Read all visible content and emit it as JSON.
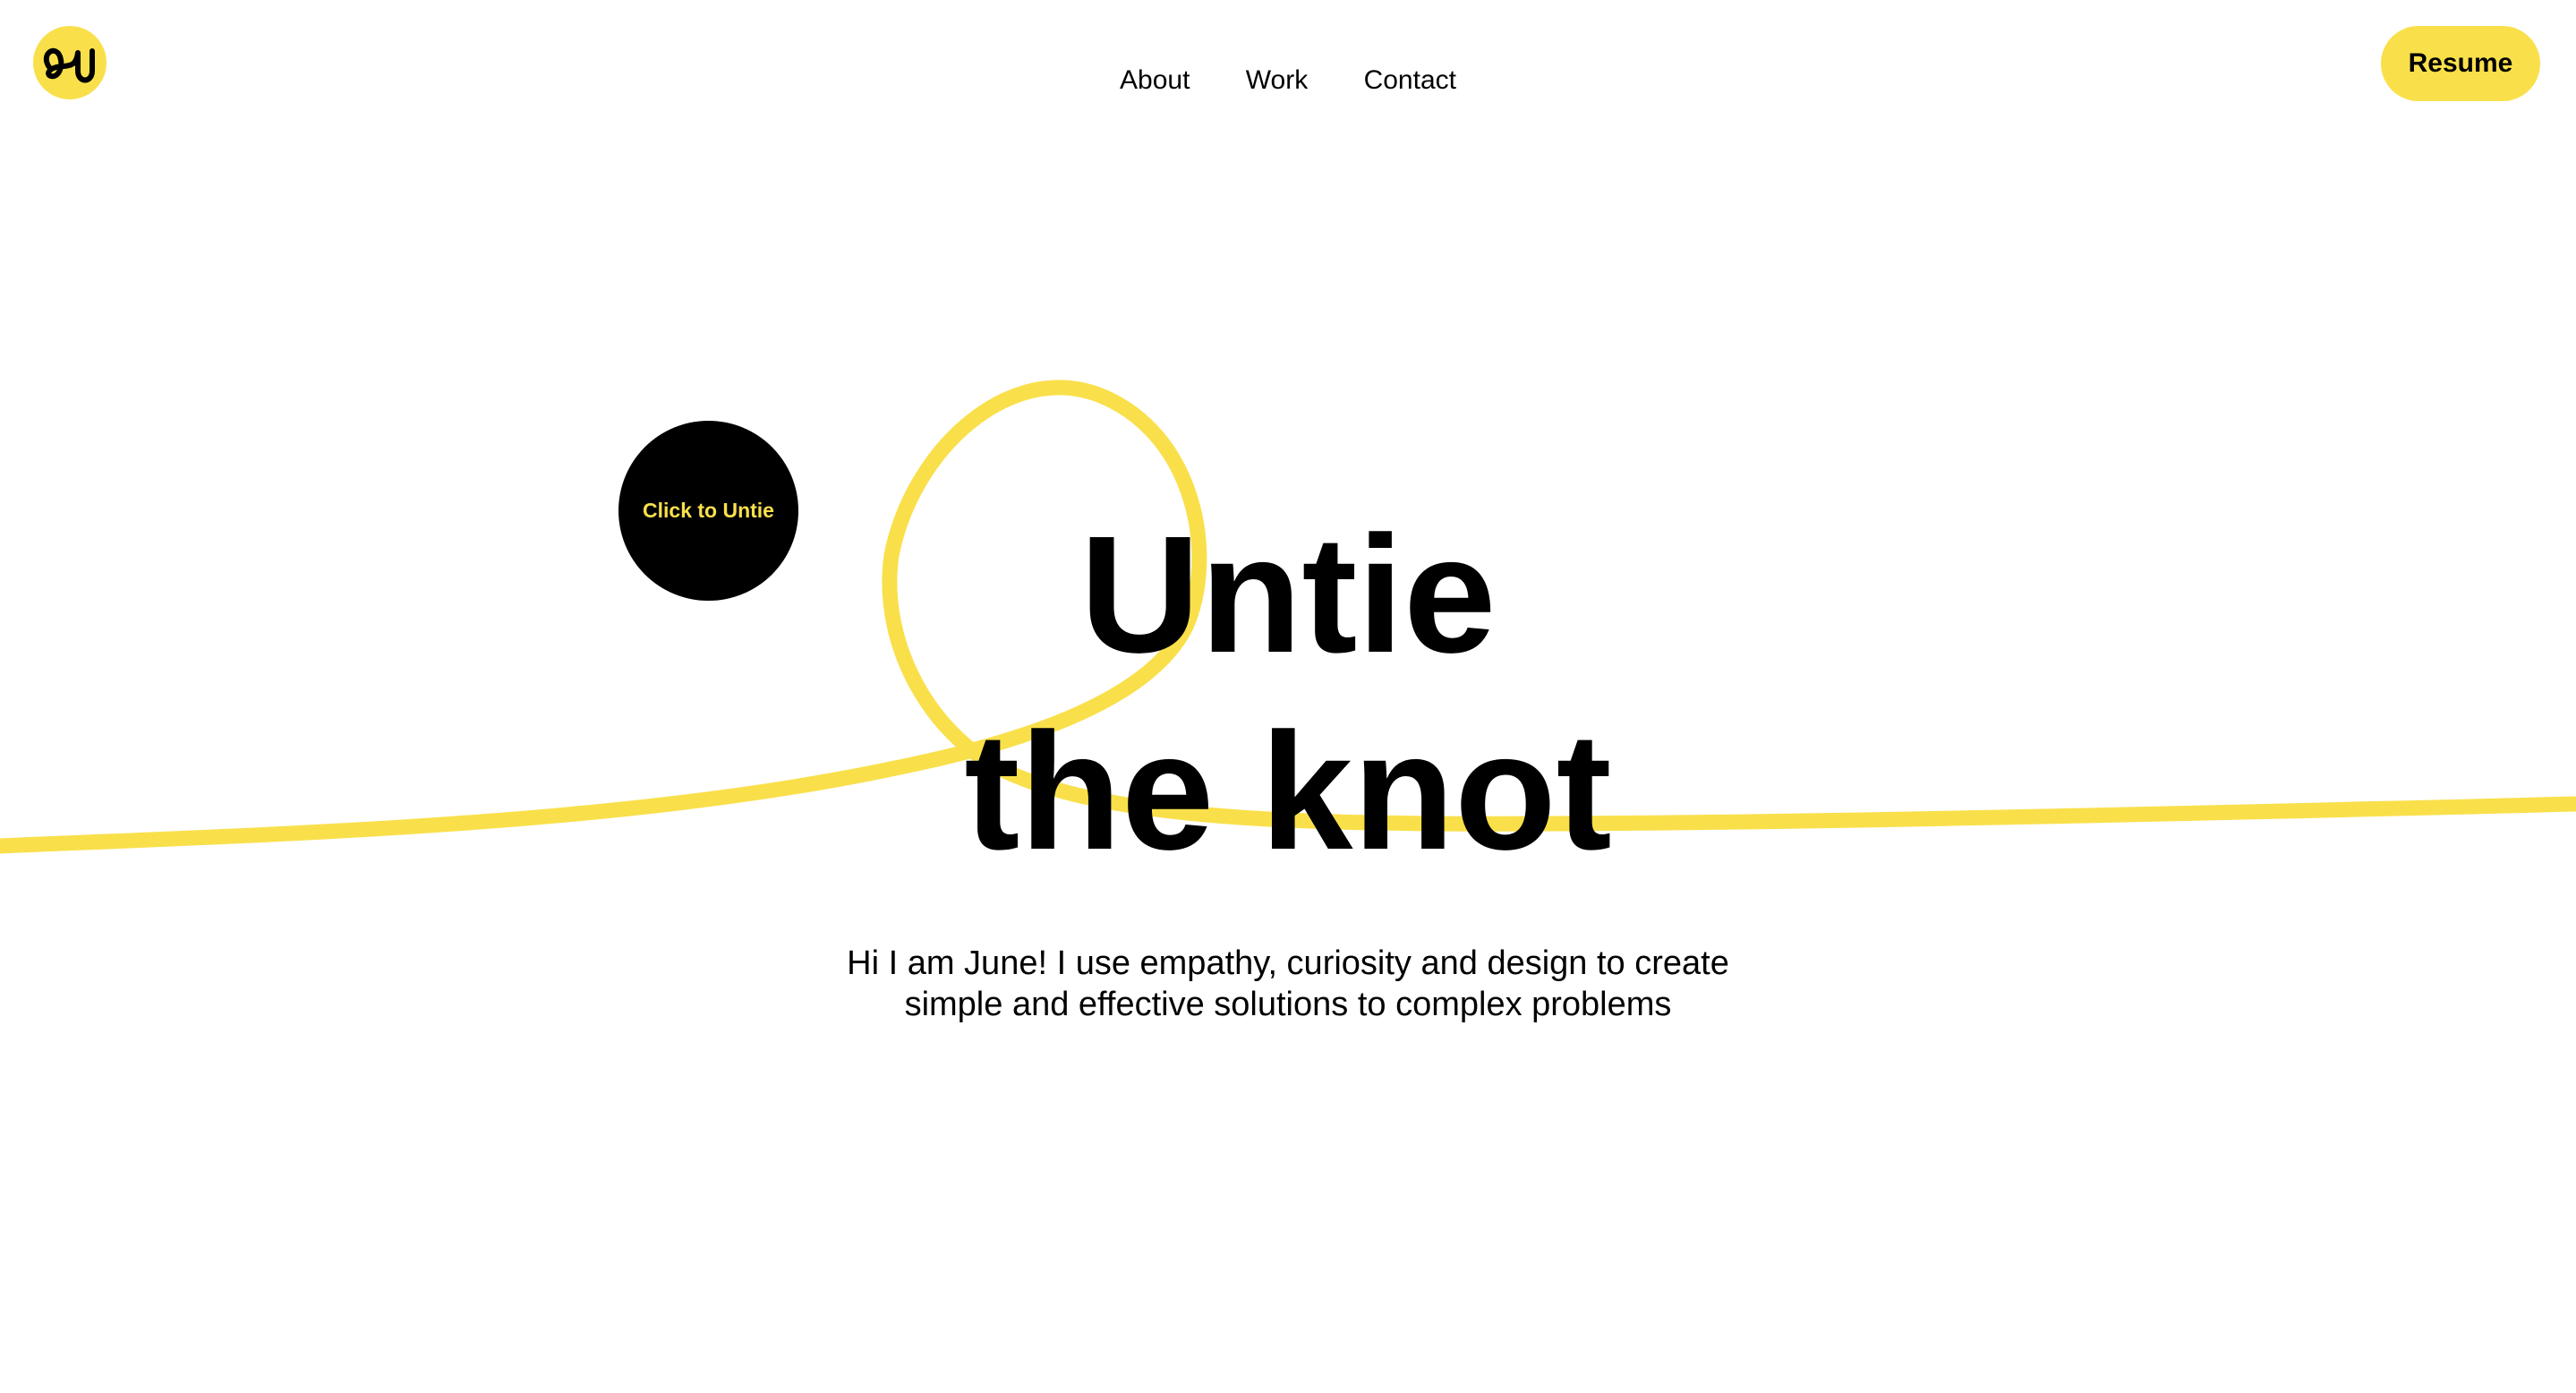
{
  "header": {
    "logo_icon": "ju-monogram-logo",
    "nav": [
      {
        "label": "About"
      },
      {
        "label": "Work"
      },
      {
        "label": "Contact"
      }
    ],
    "resume_label": "Resume"
  },
  "hero": {
    "untie_label": "Click to Untie",
    "title_line1": "Untie",
    "title_line2": "the knot",
    "subtitle_line1": "Hi I am June! I use empathy, curiosity and design to create",
    "subtitle_line2": "simple and effective solutions to complex problems"
  },
  "colors": {
    "accent": "#F9E04B",
    "text": "#000000",
    "background": "#FFFFFF"
  }
}
